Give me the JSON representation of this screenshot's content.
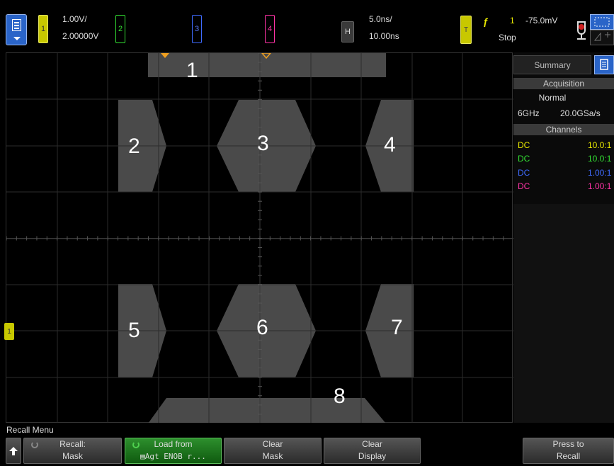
{
  "topbar": {
    "ch1": {
      "label": "1",
      "scale": "1.00V/",
      "offset": "2.00000V",
      "color": "#d8d800"
    },
    "ch2": {
      "label": "2",
      "color": "#33e033"
    },
    "ch3": {
      "label": "3",
      "color": "#3f6bff"
    },
    "ch4": {
      "label": "4",
      "color": "#ff33a6"
    },
    "horizontal": {
      "label": "H",
      "timebase": "5.0ns/",
      "delay": "10.00ns"
    },
    "trigger": {
      "label": "T",
      "edge_symbol": "ƒ",
      "source": "1",
      "level": "-75.0mV",
      "status": "Stop"
    }
  },
  "mask_regions": [
    "1",
    "2",
    "3",
    "4",
    "5",
    "6",
    "7",
    "8"
  ],
  "ground_marker": "1",
  "sidebar": {
    "tab": "Summary",
    "acquisition_header": "Acquisition",
    "acq_mode": "Normal",
    "bandwidth": "6GHz",
    "sample_rate": "20.0GSa/s",
    "channels_header": "Channels",
    "channels": [
      {
        "coupling": "DC",
        "probe": "10.0:1",
        "color": "#e8e800"
      },
      {
        "coupling": "DC",
        "probe": "10.0:1",
        "color": "#33e033"
      },
      {
        "coupling": "DC",
        "probe": "1.00:1",
        "color": "#3f6bff"
      },
      {
        "coupling": "DC",
        "probe": "1.00:1",
        "color": "#ff33a6"
      }
    ]
  },
  "softkeys": {
    "menu_title": "Recall Menu",
    "keys": [
      {
        "l1": "Recall:",
        "l2": "Mask"
      },
      {
        "l1": "Load from",
        "l2": "Agt ENOB r..."
      },
      {
        "l1": "Clear",
        "l2": "Mask"
      },
      {
        "l1": "Clear",
        "l2": "Display"
      },
      {
        "l1": "Press to",
        "l2": "Recall"
      }
    ]
  }
}
